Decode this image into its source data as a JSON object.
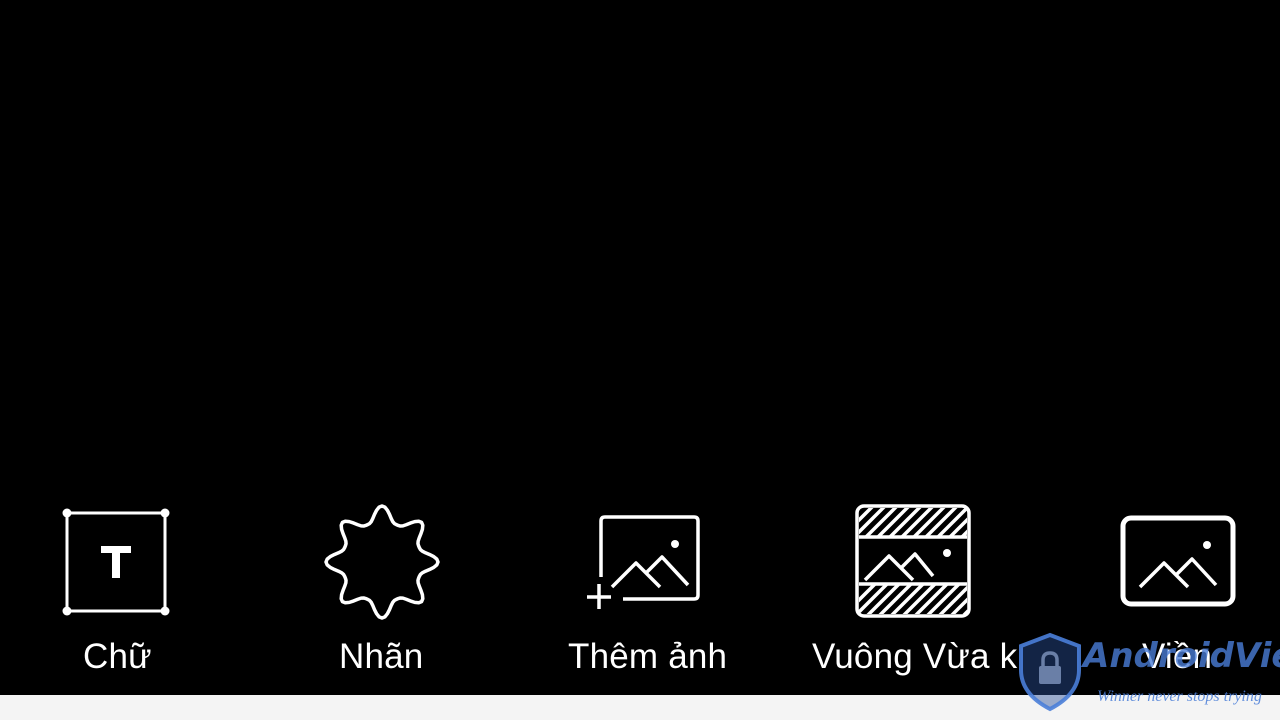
{
  "toolbar": {
    "items": [
      {
        "label": "Chữ",
        "icon": "text-box-icon"
      },
      {
        "label": "Nhãn",
        "icon": "sticker-badge-icon"
      },
      {
        "label": "Thêm ảnh",
        "icon": "add-photo-icon"
      },
      {
        "label": "Vuông Vừa k",
        "icon": "square-fit-icon"
      },
      {
        "label": "Viền",
        "icon": "border-frame-icon"
      }
    ]
  },
  "watermark": {
    "name": "AndroidViet",
    "tagline": "Winner never stops trying"
  },
  "colors": {
    "background": "#000000",
    "icon_stroke": "#ffffff",
    "label": "#ffffff",
    "bottom_strip": "#f4f4f4",
    "watermark_blue": "#4a7ed8"
  }
}
